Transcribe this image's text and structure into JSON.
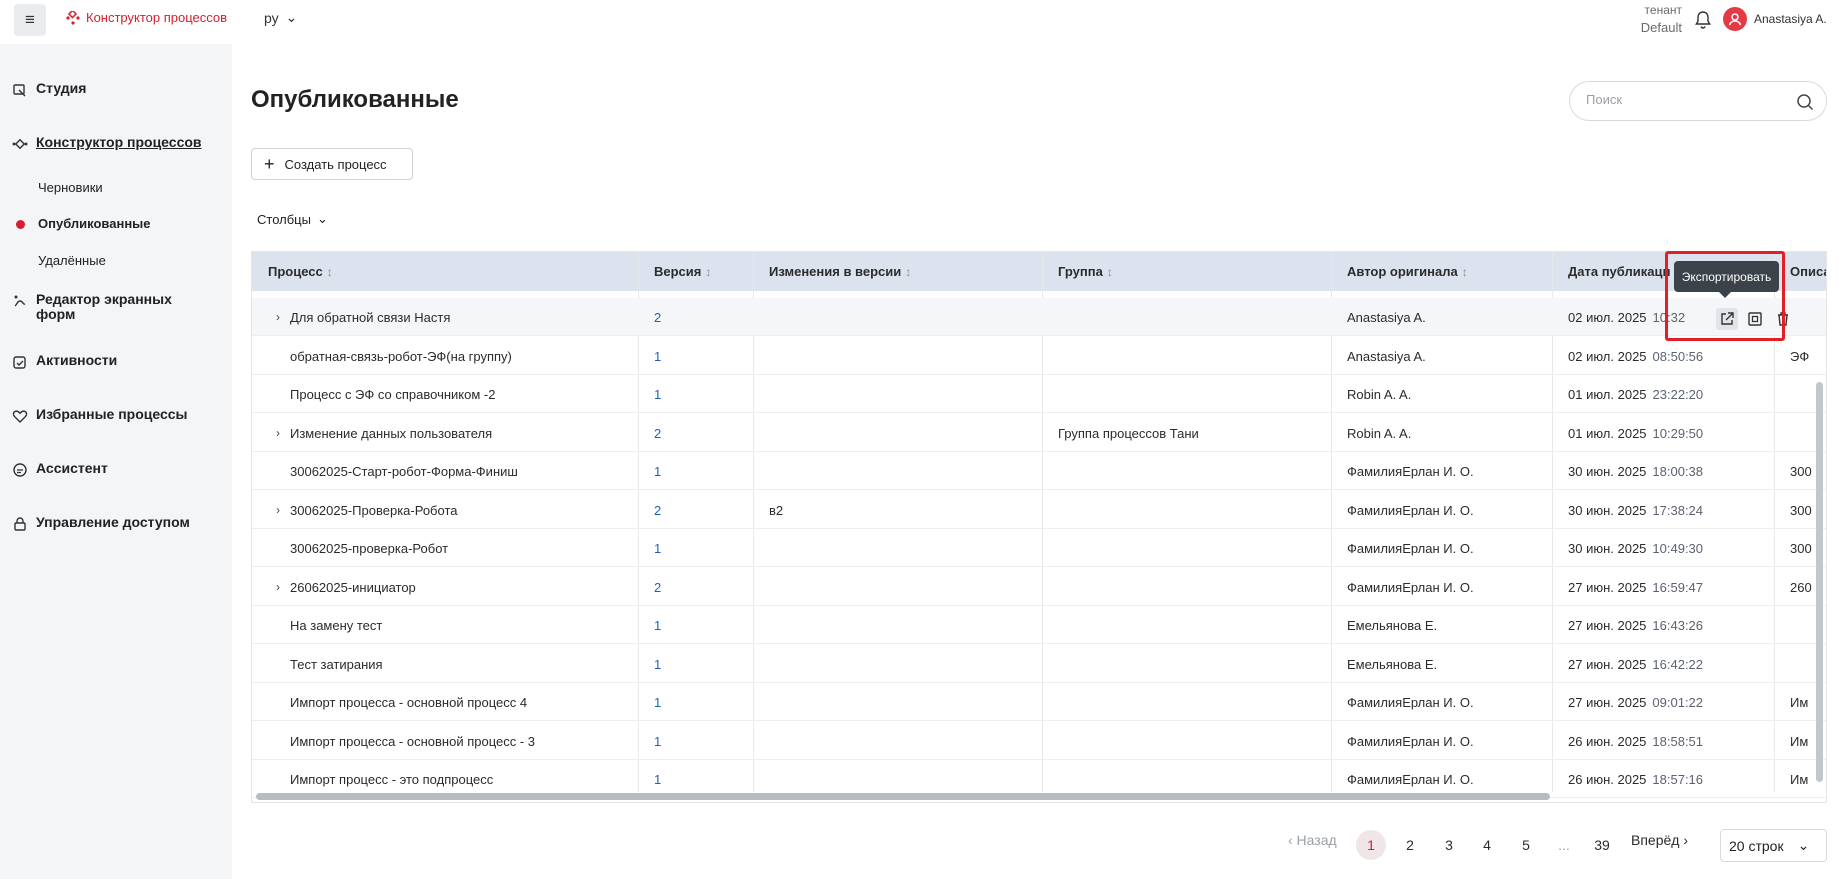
{
  "header": {
    "app_title": "Конструктор процессов",
    "language": "ру",
    "tenant_label": "тенант",
    "tenant_value": "Default",
    "user_name": "Anastasiya A."
  },
  "sidebar": {
    "items": [
      {
        "label": "Студия",
        "icon": "studio-icon"
      },
      {
        "label": "Конструктор процессов",
        "icon": "process-constructor-icon"
      },
      {
        "label": "Редактор экранных форм",
        "icon": "form-editor-icon"
      },
      {
        "label": "Активности",
        "icon": "activities-icon"
      },
      {
        "label": "Избранные процессы",
        "icon": "heart-icon"
      },
      {
        "label": "Ассистент",
        "icon": "assistant-icon"
      },
      {
        "label": "Управление доступом",
        "icon": "access-icon"
      }
    ],
    "subitems": [
      {
        "label": "Черновики"
      },
      {
        "label": "Опубликованные"
      },
      {
        "label": "Удалённые"
      }
    ]
  },
  "main": {
    "title": "Опубликованные",
    "search_placeholder": "Поиск",
    "create_button": "Создать процесс",
    "columns_button": "Столбцы"
  },
  "table": {
    "headers": [
      "Процесс",
      "Версия",
      "Изменения в версии",
      "Группа",
      "Автор оригинала",
      "Дата публикаци",
      "Описа"
    ],
    "sort_glyph": "↕",
    "rows": [
      {
        "expand": true,
        "process": "Для обратной связи Настя",
        "version": "2",
        "changes": "",
        "group": "",
        "author": "Anastasiya A.",
        "date": "02 июл. 2025",
        "time": "10:32",
        "desc": ""
      },
      {
        "expand": false,
        "process": "обратная-связь-робот-ЭФ(на группу)",
        "version": "1",
        "changes": "",
        "group": "",
        "author": "Anastasiya A.",
        "date": "02 июл. 2025",
        "time": "08:50:56",
        "desc": "ЭФ"
      },
      {
        "expand": false,
        "process": "Процесс с ЭФ со справочником -2",
        "version": "1",
        "changes": "",
        "group": "",
        "author": "Robin A. A.",
        "date": "01 июл. 2025",
        "time": "23:22:20",
        "desc": ""
      },
      {
        "expand": true,
        "process": "Изменение данных пользователя",
        "version": "2",
        "changes": "",
        "group": "Группа процессов Тани",
        "author": "Robin A. A.",
        "date": "01 июл. 2025",
        "time": "10:29:50",
        "desc": ""
      },
      {
        "expand": false,
        "process": "30062025-Старт-робот-Форма-Финиш",
        "version": "1",
        "changes": "",
        "group": "",
        "author": "ФамилияЕрлан И. О.",
        "date": "30 июн. 2025",
        "time": "18:00:38",
        "desc": "300"
      },
      {
        "expand": true,
        "process": "30062025-Проверка-Робота",
        "version": "2",
        "changes": "в2",
        "group": "",
        "author": "ФамилияЕрлан И. О.",
        "date": "30 июн. 2025",
        "time": "17:38:24",
        "desc": "300"
      },
      {
        "expand": false,
        "process": "30062025-проверка-Робот",
        "version": "1",
        "changes": "",
        "group": "",
        "author": "ФамилияЕрлан И. О.",
        "date": "30 июн. 2025",
        "time": "10:49:30",
        "desc": "300"
      },
      {
        "expand": true,
        "process": "26062025-инициатор",
        "version": "2",
        "changes": "",
        "group": "",
        "author": "ФамилияЕрлан И. О.",
        "date": "27 июн. 2025",
        "time": "16:59:47",
        "desc": "260"
      },
      {
        "expand": false,
        "process": "На замену тест",
        "version": "1",
        "changes": "",
        "group": "",
        "author": "Емельянова Е.",
        "date": "27 июн. 2025",
        "time": "16:43:26",
        "desc": ""
      },
      {
        "expand": false,
        "process": "Тест затирания",
        "version": "1",
        "changes": "",
        "group": "",
        "author": "Емельянова Е.",
        "date": "27 июн. 2025",
        "time": "16:42:22",
        "desc": ""
      },
      {
        "expand": false,
        "process": "Импорт процесса - основной процесс 4",
        "version": "1",
        "changes": "",
        "group": "",
        "author": "ФамилияЕрлан И. О.",
        "date": "27 июн. 2025",
        "time": "09:01:22",
        "desc": "Им"
      },
      {
        "expand": false,
        "process": "Импорт процесса - основной процесс - 3",
        "version": "1",
        "changes": "",
        "group": "",
        "author": "ФамилияЕрлан И. О.",
        "date": "26 июн. 2025",
        "time": "18:58:51",
        "desc": "Им"
      },
      {
        "expand": false,
        "process": "Импорт процесс - это подпроцесс",
        "version": "1",
        "changes": "",
        "group": "",
        "author": "ФамилияЕрлан И. О.",
        "date": "26 июн. 2025",
        "time": "18:57:16",
        "desc": "Им"
      }
    ],
    "row_actions": {
      "tooltip": "Экспортировать",
      "icons": [
        "export-icon",
        "preview-icon",
        "delete-icon"
      ]
    }
  },
  "pagination": {
    "prev": "‹ Назад",
    "pages": [
      "1",
      "2",
      "3",
      "4",
      "5",
      "...",
      "39"
    ],
    "current": "1",
    "next": "Вперёд ›",
    "per_page": "20 строк"
  },
  "colors": {
    "accent": "#d3202f",
    "highlight_box": "#e21f26",
    "header_bg": "#dde3ee",
    "link": "#1f5fbf"
  }
}
